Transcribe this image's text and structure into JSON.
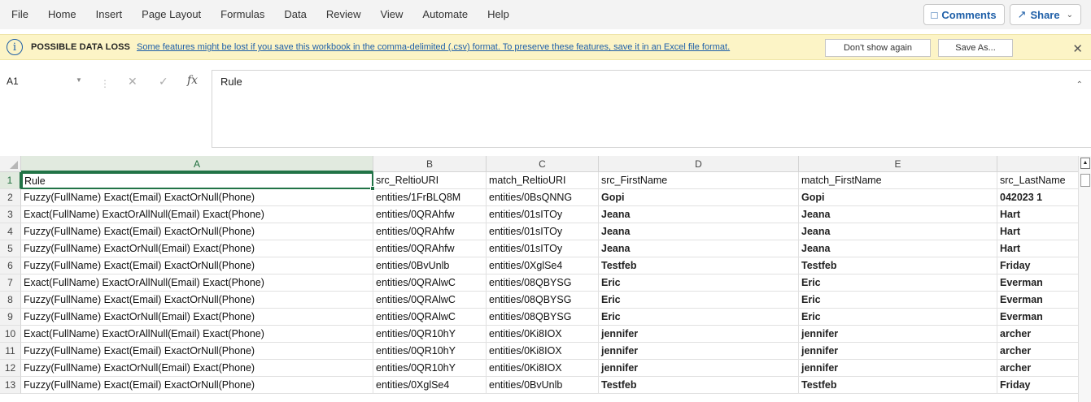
{
  "ribbon": {
    "menu": [
      "File",
      "Home",
      "Insert",
      "Page Layout",
      "Formulas",
      "Data",
      "Review",
      "View",
      "Automate",
      "Help"
    ],
    "comments_label": "Comments",
    "share_label": "Share"
  },
  "message_bar": {
    "title": "POSSIBLE DATA LOSS",
    "text": "Some features might be lost if you save this workbook in the comma-delimited (.csv) format. To preserve these features, save it in an Excel file format.",
    "dont_show_label": "Don't show again",
    "save_as_label": "Save As..."
  },
  "formula_bar": {
    "name_box": "A1",
    "formula": "Rule"
  },
  "sheet": {
    "columns": [
      "A",
      "B",
      "C",
      "D",
      "E",
      ""
    ],
    "selected_column": "A",
    "selected_row": "1",
    "rows": [
      {
        "num": "1",
        "cells": [
          "Rule",
          "src_ReltioURI",
          "match_ReltioURI",
          "src_FirstName",
          "match_FirstName",
          "src_LastName"
        ]
      },
      {
        "num": "2",
        "cells": [
          "Fuzzy(FullName) Exact(Email) ExactOrNull(Phone)",
          "entities/1FrBLQ8M",
          "entities/0BsQNNG",
          "Gopi",
          "Gopi",
          "042023 1"
        ]
      },
      {
        "num": "3",
        "cells": [
          "Exact(FullName) ExactOrAllNull(Email) Exact(Phone)",
          "entities/0QRAhfw",
          "entities/01sITOy",
          "Jeana",
          "Jeana",
          "Hart"
        ]
      },
      {
        "num": "4",
        "cells": [
          "Fuzzy(FullName) Exact(Email) ExactOrNull(Phone)",
          "entities/0QRAhfw",
          "entities/01sITOy",
          "Jeana",
          "Jeana",
          "Hart"
        ]
      },
      {
        "num": "5",
        "cells": [
          "Fuzzy(FullName) ExactOrNull(Email) Exact(Phone)",
          "entities/0QRAhfw",
          "entities/01sITOy",
          "Jeana",
          "Jeana",
          "Hart"
        ]
      },
      {
        "num": "6",
        "cells": [
          "Fuzzy(FullName) Exact(Email) ExactOrNull(Phone)",
          "entities/0BvUnlb",
          "entities/0XglSe4",
          "Testfeb",
          "Testfeb",
          "Friday"
        ]
      },
      {
        "num": "7",
        "cells": [
          "Exact(FullName) ExactOrAllNull(Email) Exact(Phone)",
          "entities/0QRAlwC",
          "entities/08QBYSG",
          "Eric",
          "Eric",
          "Everman"
        ]
      },
      {
        "num": "8",
        "cells": [
          "Fuzzy(FullName) Exact(Email) ExactOrNull(Phone)",
          "entities/0QRAlwC",
          "entities/08QBYSG",
          "Eric",
          "Eric",
          "Everman"
        ]
      },
      {
        "num": "9",
        "cells": [
          "Fuzzy(FullName) ExactOrNull(Email) Exact(Phone)",
          "entities/0QRAlwC",
          "entities/08QBYSG",
          "Eric",
          "Eric",
          "Everman"
        ]
      },
      {
        "num": "10",
        "cells": [
          "Exact(FullName) ExactOrAllNull(Email) Exact(Phone)",
          "entities/0QR10hY",
          "entities/0Ki8IOX",
          "jennifer",
          "jennifer",
          "archer"
        ]
      },
      {
        "num": "11",
        "cells": [
          "Fuzzy(FullName) Exact(Email) ExactOrNull(Phone)",
          "entities/0QR10hY",
          "entities/0Ki8IOX",
          "jennifer",
          "jennifer",
          "archer"
        ]
      },
      {
        "num": "12",
        "cells": [
          "Fuzzy(FullName) ExactOrNull(Email) Exact(Phone)",
          "entities/0QR10hY",
          "entities/0Ki8IOX",
          "jennifer",
          "jennifer",
          "archer"
        ]
      },
      {
        "num": "13",
        "cells": [
          "Fuzzy(FullName) Exact(Email) ExactOrNull(Phone)",
          "entities/0XglSe4",
          "entities/0BvUnlb",
          "Testfeb",
          "Testfeb",
          "Friday"
        ]
      }
    ]
  },
  "colors": {
    "accent_green": "#217346",
    "link_blue": "#1e5fa8",
    "warning_bg": "#fcf4c6"
  }
}
